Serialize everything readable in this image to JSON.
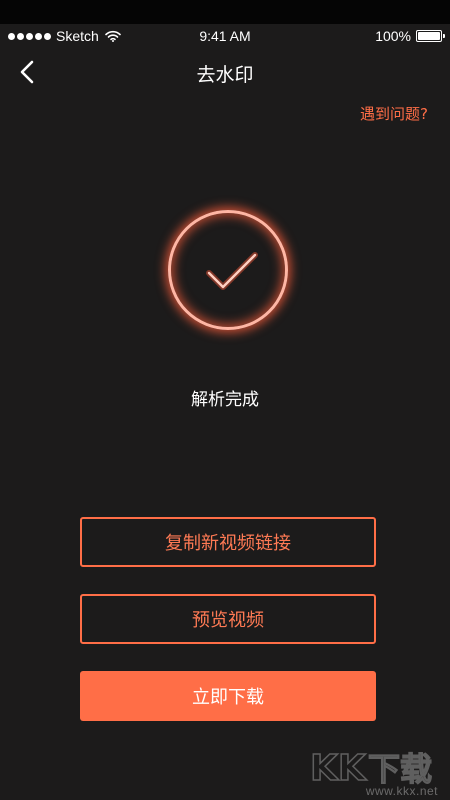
{
  "status_bar": {
    "carrier": "Sketch",
    "time": "9:41 AM",
    "battery": "100%"
  },
  "nav": {
    "title": "去水印"
  },
  "help_link": "遇到问题?",
  "status_text": "解析完成",
  "buttons": {
    "copy": "复制新视频链接",
    "preview": "预览视频",
    "download": "立即下载"
  },
  "watermark": {
    "logo_text": "KK下载",
    "url": "www.kkx.net"
  },
  "colors": {
    "accent": "#ff6e47",
    "background": "#1c1b1b",
    "glow": "#ffb6a4"
  },
  "icons": [
    "back-arrow-icon",
    "wifi-icon",
    "battery-icon",
    "checkmark-icon"
  ]
}
